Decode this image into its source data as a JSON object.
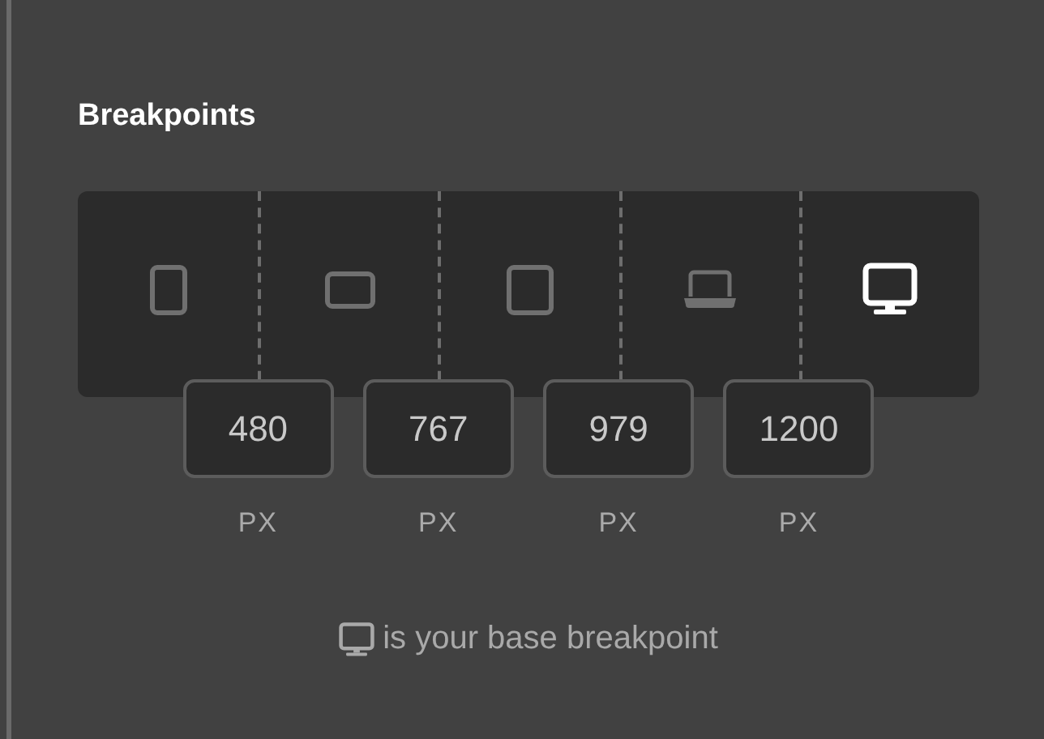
{
  "title": "Breakpoints",
  "devices": [
    {
      "kind": "phone",
      "selected": false
    },
    {
      "kind": "phone-landscape",
      "selected": false
    },
    {
      "kind": "tablet",
      "selected": false
    },
    {
      "kind": "laptop",
      "selected": false
    },
    {
      "kind": "desktop",
      "selected": true
    }
  ],
  "breakpoints": [
    {
      "value": "480",
      "unit": "PX"
    },
    {
      "value": "767",
      "unit": "PX"
    },
    {
      "value": "979",
      "unit": "PX"
    },
    {
      "value": "1200",
      "unit": "PX"
    }
  ],
  "footer": {
    "text": "is your base breakpoint"
  }
}
